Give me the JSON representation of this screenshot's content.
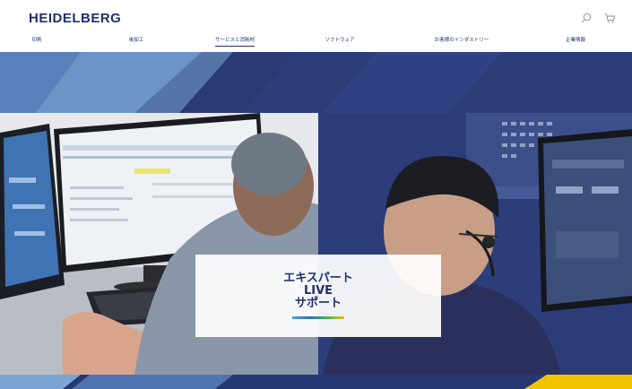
{
  "brand": {
    "logo": "HEIDELBERG"
  },
  "nav": {
    "items": [
      {
        "label": "印刷"
      },
      {
        "label": "後加工"
      },
      {
        "label": "サービスと消耗材"
      },
      {
        "label": "ソフトウェア"
      },
      {
        "label": "お客様のインダストリー"
      },
      {
        "label": "企業情報"
      }
    ],
    "active_index": 2
  },
  "utilities": {
    "search_icon": "search-icon",
    "cart_icon": "cart-icon"
  },
  "hero": {
    "lines": [
      "エキスパート",
      "LIVE",
      "サポート"
    ]
  },
  "colors": {
    "brand_navy": "#1d2f6f",
    "hero_blue": "#27376e",
    "accent_light_blue": "#4fa3d9",
    "accent_yellow": "#f2c400"
  }
}
